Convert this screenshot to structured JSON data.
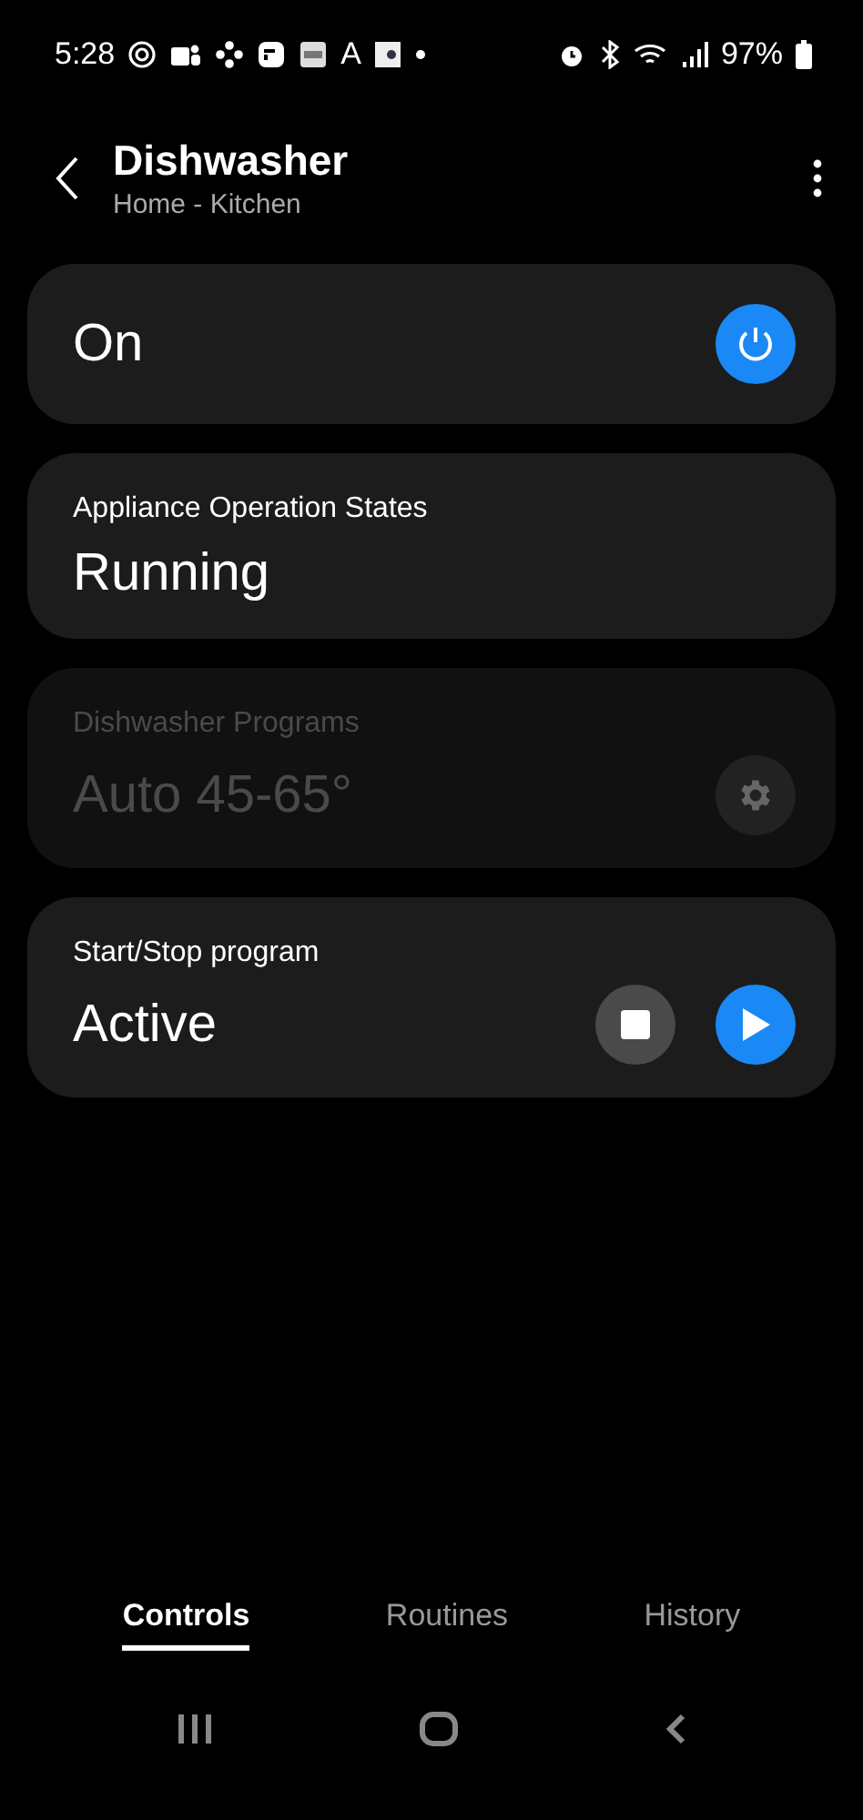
{
  "status_bar": {
    "time": "5:28",
    "letter_icon": "A",
    "battery": "97%"
  },
  "header": {
    "title": "Dishwasher",
    "subtitle": "Home - Kitchen"
  },
  "cards": [
    {
      "kind": "power",
      "value": "On",
      "on": true
    },
    {
      "kind": "status",
      "label": "Appliance Operation States",
      "value": "Running"
    },
    {
      "kind": "setting",
      "label": "Dishwasher Programs",
      "value": "Auto 45-65°",
      "disabled": true
    },
    {
      "kind": "startstop",
      "label": "Start/Stop program",
      "value": "Active"
    }
  ],
  "tabs": [
    {
      "label": "Controls",
      "selected": true
    },
    {
      "label": "Routines",
      "selected": false
    },
    {
      "label": "History",
      "selected": false
    }
  ]
}
